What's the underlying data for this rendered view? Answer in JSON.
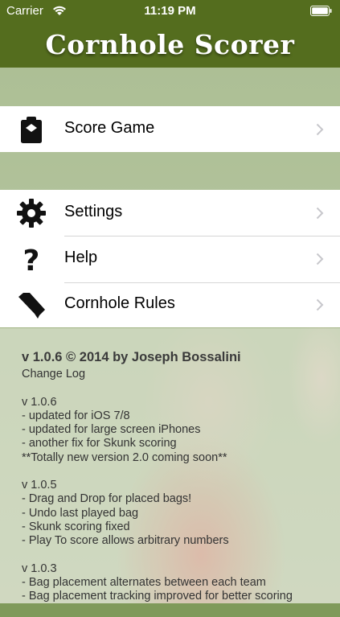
{
  "status_bar": {
    "carrier": "Carrier",
    "time": "11:19 PM"
  },
  "header": {
    "title": "Cornhole Scorer",
    "background_color": "#546d1e"
  },
  "menu": {
    "score_game": {
      "label": "Score Game",
      "icon": "clipboard-icon"
    },
    "settings": {
      "label": "Settings",
      "icon": "gear-icon"
    },
    "help": {
      "label": "Help",
      "icon": "question-mark-icon"
    },
    "rules": {
      "label": "Cornhole Rules",
      "icon": "bookmark-icon"
    }
  },
  "info": {
    "version_line": "v 1.0.6 © 2014 by Joseph Bossalini",
    "changelog_label": "Change Log",
    "sections": [
      {
        "title": "v 1.0.6",
        "lines": [
          "- updated for iOS 7/8",
          "- updated for large screen iPhones",
          "- another fix for Skunk scoring",
          "**Totally new version 2.0 coming soon**"
        ]
      },
      {
        "title": "v 1.0.5",
        "lines": [
          "- Drag and Drop for placed bags!",
          "- Undo last played bag",
          "- Skunk scoring fixed",
          "- Play To score allows arbitrary numbers"
        ]
      },
      {
        "title": "v 1.0.3",
        "lines": [
          "- Bag placement alternates between each team",
          "- Bag placement tracking improved for better scoring"
        ]
      }
    ]
  }
}
